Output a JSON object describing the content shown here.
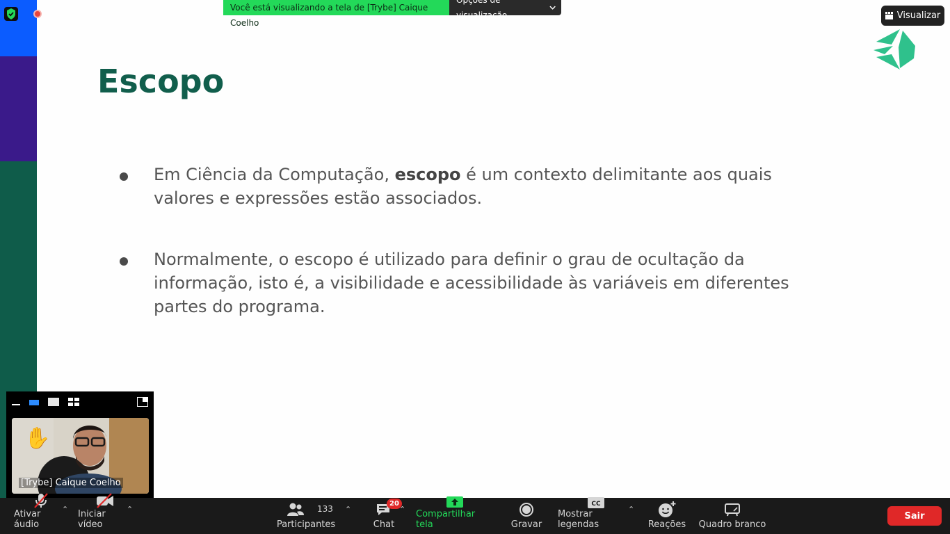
{
  "banner": {
    "viewing_text": "Você está visualizando a tela de [Trybe] Caique Coelho",
    "options_label": "Opções de visualização"
  },
  "view_button": {
    "label": "Visualizar"
  },
  "slide": {
    "title": "Escopo",
    "bullet1_pre": "Em Ciência da Computação, ",
    "bullet1_bold": "escopo",
    "bullet1_post": " é um contexto delimitante aos quais\nvalores e expressões estão associados.",
    "bullet2": "Normalmente, o escopo é utilizado para definir o grau de ocultação da\ninformação, isto é, a visibilidade e acessibilidade às variáveis em diferentes\npartes do programa."
  },
  "self_view": {
    "name": "[Trybe] Caique Coelho"
  },
  "toolbar": {
    "audio": "Ativar áudio",
    "video": "Iniciar vídeo",
    "participants": "Participantes",
    "participants_count": "133",
    "chat": "Chat",
    "chat_badge": "20",
    "share": "Compartilhar tela",
    "record": "Gravar",
    "captions": "Mostrar legendas",
    "reactions": "Reações",
    "whiteboard": "Quadro branco",
    "leave": "Sair"
  },
  "colors": {
    "title": "#115e4c",
    "banner_green": "#23d959",
    "leave_red": "#e02828",
    "strip_blue": "#0b5cff",
    "strip_purple": "#3a1a8a",
    "strip_green": "#0f5c4a"
  }
}
